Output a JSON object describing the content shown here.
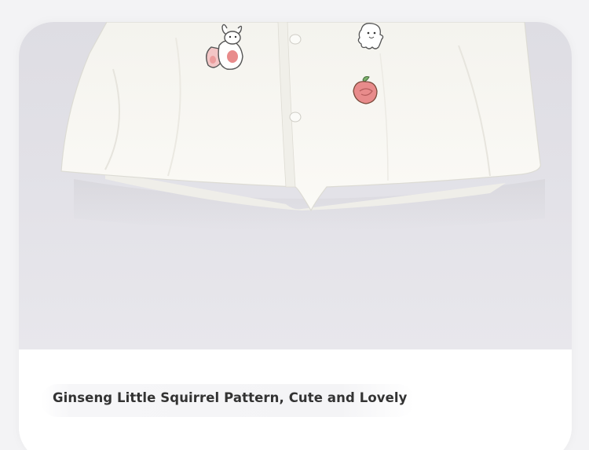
{
  "caption": {
    "text": "Ginseng Little Squirrel Pattern, Cute and Lovely"
  },
  "photo": {
    "subject": "white-shirt-hem",
    "motifs": [
      "squirrel-icon",
      "ghost-icon",
      "peach-icon"
    ]
  },
  "colors": {
    "background": "#f3f3f5",
    "card": "#ffffff",
    "backdrop": "#e2e1e7",
    "shirt": "#f7f6f1",
    "caption_text": "#333333",
    "accent_pink": "#e88b8b"
  }
}
